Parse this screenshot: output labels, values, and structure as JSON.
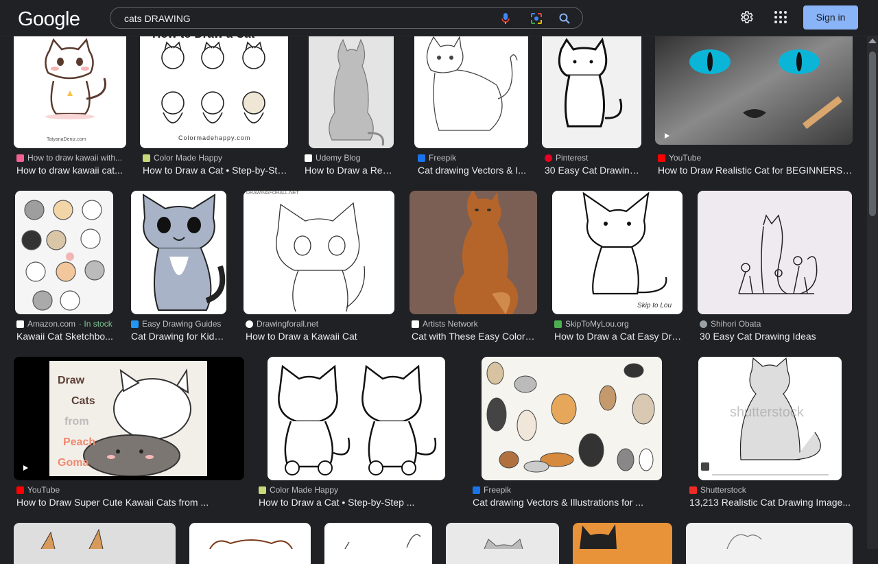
{
  "header": {
    "logo": "Google",
    "query": "cats DRAWING",
    "signin": "Sign in"
  },
  "results": [
    {
      "source": "How to draw kawaii with...",
      "title": "How to draw kawaii cat...",
      "thumb_text": "TatyanaDeniz.com"
    },
    {
      "source": "Color Made Happy",
      "title": "How to Draw a Cat • Step-by-Ste...",
      "thumb_text": "How to Draw a Cat",
      "thumb_text2": "Colormadehappy.com"
    },
    {
      "source": "Udemy Blog",
      "title": "How to Draw a Reali..."
    },
    {
      "source": "Freepik",
      "title": "Cat drawing Vectors & I..."
    },
    {
      "source": "Pinterest",
      "title": "30 Easy Cat Drawing..."
    },
    {
      "source": "YouTube",
      "title": "How to Draw Realistic Cat for BEGINNERS ..."
    },
    {
      "source": "Amazon.com",
      "source_extra": "· In stock",
      "title": "Kawaii Cat Sketchbo..."
    },
    {
      "source": "Easy Drawing Guides",
      "title": "Cat Drawing for Kids..."
    },
    {
      "source": "Drawingforall.net",
      "title": "How to Draw a Kawaii Cat",
      "thumb_text": "DRAWINGFORALL.NET"
    },
    {
      "source": "Artists Network",
      "title": "Cat with These Easy Colore..."
    },
    {
      "source": "SkipToMyLou.org",
      "title": "How to Draw a Cat Easy Dra...",
      "thumb_text": "Skip to Lou"
    },
    {
      "source": "Shihori Obata",
      "title": "30 Easy Cat Drawing Ideas"
    },
    {
      "source": "YouTube",
      "title": "How to Draw Super Cute Kawaii Cats from ...",
      "thumb_lines": [
        "Draw",
        "Cats",
        "from",
        "Peach",
        "Goma"
      ]
    },
    {
      "source": "Color Made Happy",
      "title": "How to Draw a Cat • Step-by-Step ..."
    },
    {
      "source": "Freepik",
      "title": "Cat drawing Vectors & Illustrations for ..."
    },
    {
      "source": "Shutterstock",
      "title": "13,213 Realistic Cat Drawing Image...",
      "thumb_text": "shutterstock"
    }
  ],
  "colors": {
    "background": "#202124",
    "accent": "#8ab4f8",
    "in_stock": "#81c995"
  }
}
